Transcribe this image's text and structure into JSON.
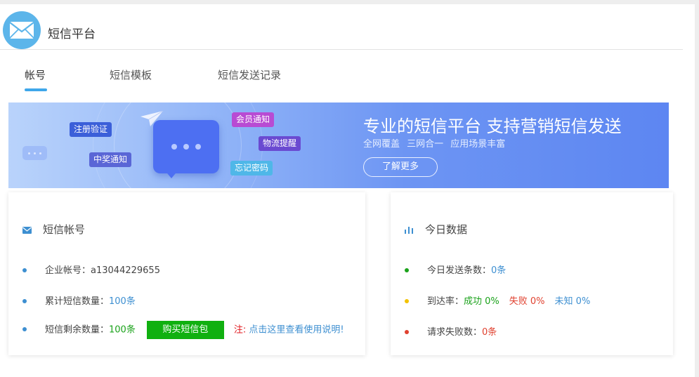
{
  "app": {
    "title": "短信平台"
  },
  "tabs": [
    {
      "label": "帐号",
      "active": true
    },
    {
      "label": "短信模板",
      "active": false
    },
    {
      "label": "短信发送记录",
      "active": false
    }
  ],
  "banner": {
    "title": "专业的短信平台  支持营销短信发送",
    "subtitle": "全网覆盖  三网合一  应用场景丰富",
    "button": "了解更多",
    "tags": {
      "register": "注册验证",
      "prize": "中奖通知",
      "member": "会员通知",
      "logistics": "物流提醒",
      "password": "忘记密码"
    }
  },
  "account_card": {
    "title": "短信帐号",
    "icon": "mail-icon",
    "enterprise_label": "企业帐号：",
    "enterprise_value": "a13044229655",
    "total_label": "累计短信数量：",
    "total_value": "100条",
    "remaining_label": "短信剩余数量：",
    "remaining_value": "100条",
    "buy_button": "购买短信包",
    "note_label": "注:",
    "help_link": "点击这里查看使用说明!"
  },
  "today_card": {
    "title": "今日数据",
    "icon": "bar-chart-icon",
    "sent_label": "今日发送条数：",
    "sent_value": "0条",
    "arrival_label": "到达率：",
    "success": "成功 0%",
    "fail": "失败 0%",
    "unknown": "未知 0%",
    "fail_count_label": "请求失败数：",
    "fail_count_value": "0条"
  },
  "colors": {
    "accent": "#3fa7ea",
    "bullet_blue": "#3d8fd1",
    "bullet_green": "#1aa21a",
    "bullet_yellow": "#f2c200",
    "bullet_red": "#e0412f",
    "buy_button": "#10b010"
  }
}
